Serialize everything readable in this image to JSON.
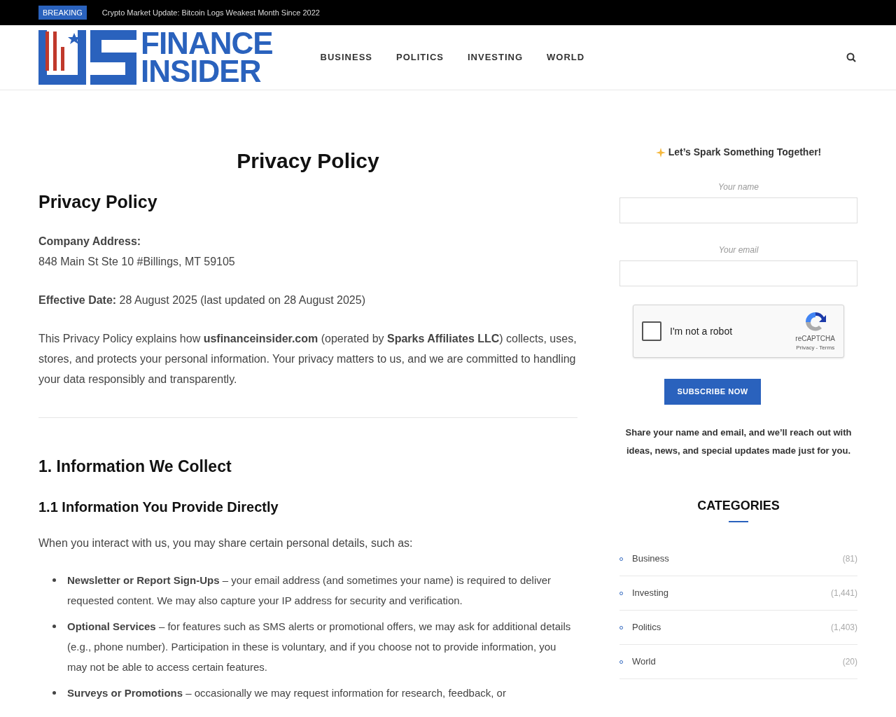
{
  "ticker": {
    "badge": "BREAKING",
    "headline": "Crypto Market Update: Bitcoin Logs Weakest Month Since 2022"
  },
  "logo": {
    "line_1": "FINANCE",
    "line_2": "INSIDER"
  },
  "nav": [
    {
      "label": "BUSINESS"
    },
    {
      "label": "POLITICS"
    },
    {
      "label": "INVESTING"
    },
    {
      "label": "WORLD"
    }
  ],
  "article": {
    "page_title": "Privacy Policy",
    "heading": "Privacy Policy",
    "address_label": "Company Address:",
    "address": "848 Main St Ste 10 #Billings, MT 59105",
    "effective": "**Effective Date:** 28 August 2025 (last updated on 28 August 2025)",
    "intro": "This Privacy Policy explains how **usfinanceinsider.com** (operated by **Sparks Affiliates LLC**) collects, uses, stores, and protects your personal information. Your privacy matters to us, and we are committed to handling your data responsibly and transparently.",
    "section_heading": "1. Information We Collect",
    "subsection_heading": "1.1 Information You Provide Directly",
    "lead": "When you interact with us, you may share certain personal details, such as:",
    "bullets": [
      "**Newsletter or Report Sign-Ups** – your email address (and sometimes your name) is required to deliver requested content. We may also capture your IP address for security and verification.",
      "**Optional Services** – for features such as SMS alerts or promotional offers, we may ask for additional details (e.g., phone number). Participation in these is voluntary, and if you choose not to provide information, you may not be able to access certain features.",
      "**Surveys or Promotions** – occasionally we may request information for research, feedback, or"
    ]
  },
  "signup": {
    "title": "Let’s Spark Something Together!",
    "name_label": "Your name",
    "email_label": "Your email",
    "captcha": {
      "checked": false,
      "label": "I'm not a robot",
      "brand": "reCAPTCHA",
      "links": "Privacy - Terms"
    },
    "button": "SUBSCRIBE NOW",
    "note": "Share your name and email, and we’ll reach out with ideas, news, and special updates made just for you."
  },
  "categories": {
    "title": "CATEGORIES",
    "items": [
      {
        "name": "Business",
        "count": "(81)"
      },
      {
        "name": "Investing",
        "count": "(1,441)"
      },
      {
        "name": "Politics",
        "count": "(1,403)"
      },
      {
        "name": "World",
        "count": "(20)"
      }
    ]
  }
}
